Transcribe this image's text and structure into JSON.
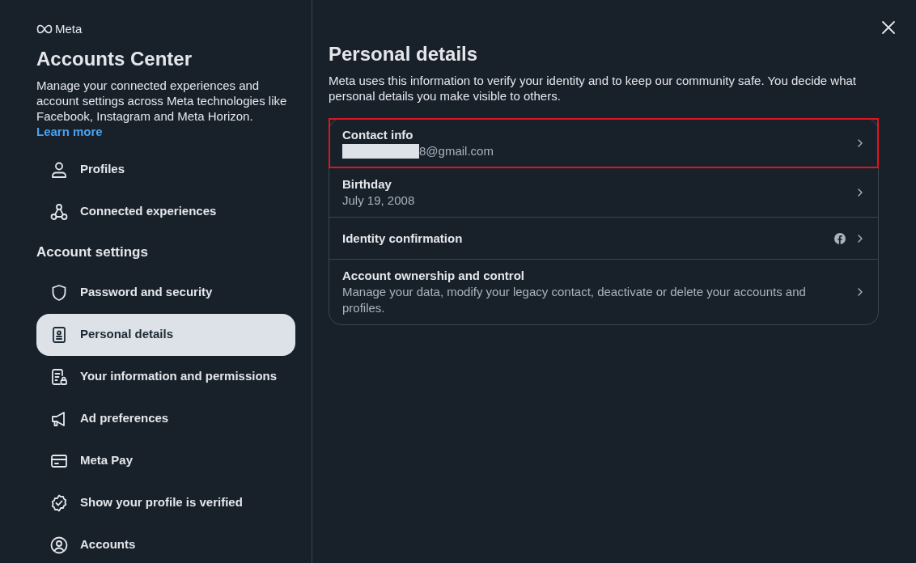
{
  "sidebar": {
    "brand": "Meta",
    "title": "Accounts Center",
    "description": "Manage your connected experiences and account settings across Meta technologies like Facebook, Instagram and Meta Horizon.",
    "learn_more": "Learn more",
    "top_items": [
      {
        "label": "Profiles",
        "selected": false
      },
      {
        "label": "Connected experiences",
        "selected": false
      }
    ],
    "section_heading": "Account settings",
    "items": [
      {
        "label": "Password and security",
        "selected": false
      },
      {
        "label": "Personal details",
        "selected": true
      },
      {
        "label": "Your information and permissions",
        "selected": false
      },
      {
        "label": "Ad preferences",
        "selected": false
      },
      {
        "label": "Meta Pay",
        "selected": false
      },
      {
        "label": "Show your profile is verified",
        "selected": false
      },
      {
        "label": "Accounts",
        "selected": false
      }
    ]
  },
  "main": {
    "title": "Personal details",
    "description": "Meta uses this information to verify your identity and to keep our community safe. You decide what personal details you make visible to others.",
    "rows": [
      {
        "title": "Contact info",
        "value": "8@gmail.com",
        "redacted": true,
        "highlighted": true,
        "facebook_badge": false
      },
      {
        "title": "Birthday",
        "value": "July 19, 2008",
        "redacted": false,
        "highlighted": false,
        "facebook_badge": false
      },
      {
        "title": "Identity confirmation",
        "redacted": false,
        "highlighted": false,
        "facebook_badge": true
      },
      {
        "title": "Account ownership and control",
        "value": "Manage your data, modify your legacy contact, deactivate or delete your accounts and profiles.",
        "redacted": false,
        "highlighted": false,
        "facebook_badge": false
      }
    ]
  }
}
